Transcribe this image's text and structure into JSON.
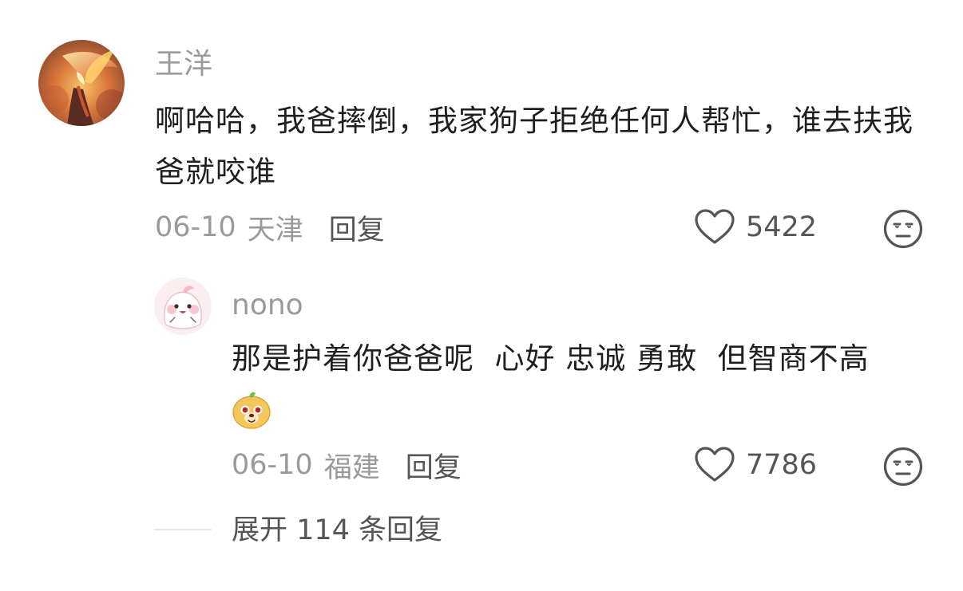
{
  "comment": {
    "username": "王洋",
    "content": "啊哈哈，我爸摔倒，我家狗子拒绝任何人帮忙，谁去扶我爸就咬谁",
    "date": "06-10",
    "location": "天津",
    "reply_label": "回复",
    "like_count": "5422",
    "avatar_icon": "phoenix-avatar",
    "dislike_icon": "unamused-face-icon"
  },
  "reply": {
    "username": "nono",
    "content": "那是护着你爸爸呢  心好 忠诚 勇敢  但智商不高",
    "emoji": "dog-face-sticker",
    "date": "06-10",
    "location": "福建",
    "reply_label": "回复",
    "like_count": "7786",
    "avatar_icon": "pink-blob-avatar",
    "dislike_icon": "unamused-face-icon"
  },
  "expand": {
    "label": "展开 114 条回复"
  },
  "colors": {
    "meta_gray": "#9a9a9a",
    "text_dark": "#1f1f1f",
    "action_gray": "#555555"
  }
}
